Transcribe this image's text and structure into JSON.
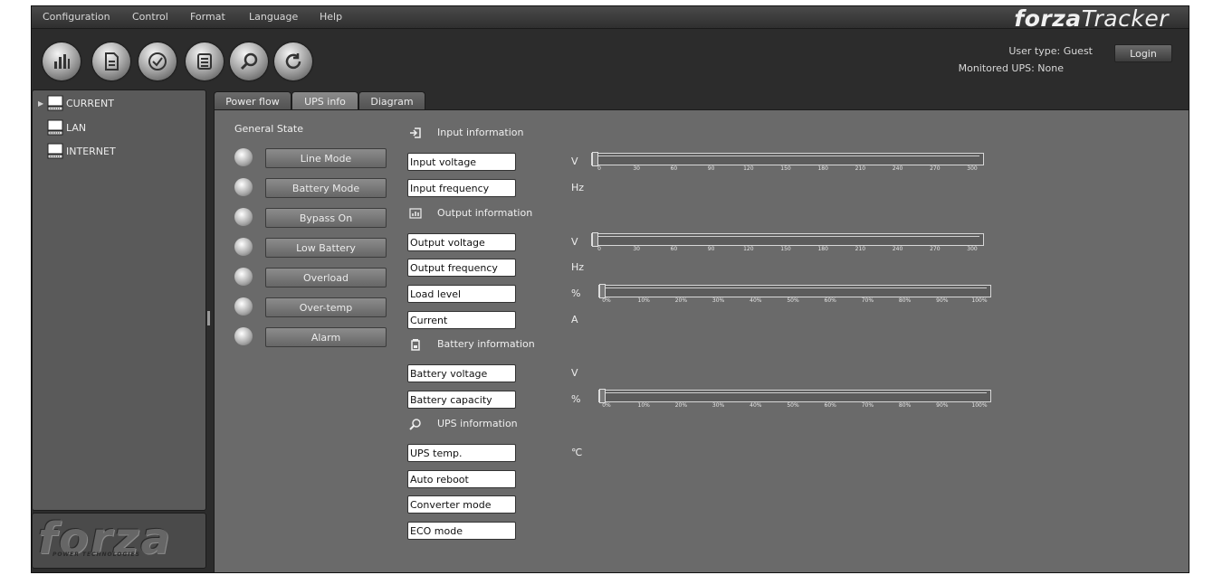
{
  "menu": [
    "Configuration",
    "Control",
    "Format",
    "Language",
    "Help"
  ],
  "brand": {
    "bold": "forza",
    "light": "Tracker"
  },
  "toolbar": [
    "bar-chart-icon",
    "document-icon",
    "check-icon",
    "list-icon",
    "search-icon",
    "refresh-icon"
  ],
  "user": {
    "type": "User type: Guest",
    "monitored": "Monitored UPS: None",
    "login": "Login"
  },
  "tree": [
    {
      "label": "CURRENT",
      "expanded": true
    },
    {
      "label": "LAN"
    },
    {
      "label": "INTERNET"
    }
  ],
  "logo": {
    "word": "forza",
    "sub": "POWER TECHNOLOGIES"
  },
  "tabs": [
    "Power flow",
    "UPS info",
    "Diagram"
  ],
  "active_tab": "UPS info",
  "general_state": {
    "title": "General State",
    "items": [
      "Line Mode",
      "Battery Mode",
      "Bypass On",
      "Low Battery",
      "Overload",
      "Over-temp",
      "Alarm"
    ]
  },
  "sections": {
    "input": "Input information",
    "output": "Output information",
    "battery": "Battery information",
    "ups": "UPS information"
  },
  "fields": {
    "input_voltage": "Input voltage",
    "input_frequency": "Input frequency",
    "output_voltage": "Output voltage",
    "output_frequency": "Output frequency",
    "load_level": "Load level",
    "current": "Current",
    "battery_voltage": "Battery voltage",
    "battery_capacity": "Battery capacity",
    "ups_temp": "UPS temp.",
    "auto_reboot": "Auto reboot",
    "converter_mode": "Converter mode",
    "eco_mode": "ECO mode"
  },
  "units": {
    "volt": "V",
    "hz": "Hz",
    "percent": "%",
    "amp": "A",
    "celsius": "℃"
  },
  "gauges": {
    "input_voltage": {
      "ticks": [
        "0",
        "30",
        "60",
        "90",
        "120",
        "150",
        "180",
        "210",
        "240",
        "270",
        "300"
      ],
      "value": 0
    },
    "output_voltage": {
      "ticks": [
        "0",
        "30",
        "60",
        "90",
        "120",
        "150",
        "180",
        "210",
        "240",
        "270",
        "300"
      ],
      "value": 0
    },
    "load_level": {
      "ticks": [
        "0%",
        "10%",
        "20%",
        "30%",
        "40%",
        "50%",
        "60%",
        "70%",
        "80%",
        "90%",
        "100%"
      ],
      "value": 0
    },
    "battery_capacity": {
      "ticks": [
        "0%",
        "10%",
        "20%",
        "30%",
        "40%",
        "50%",
        "60%",
        "70%",
        "80%",
        "90%",
        "100%"
      ],
      "value": 0
    }
  }
}
